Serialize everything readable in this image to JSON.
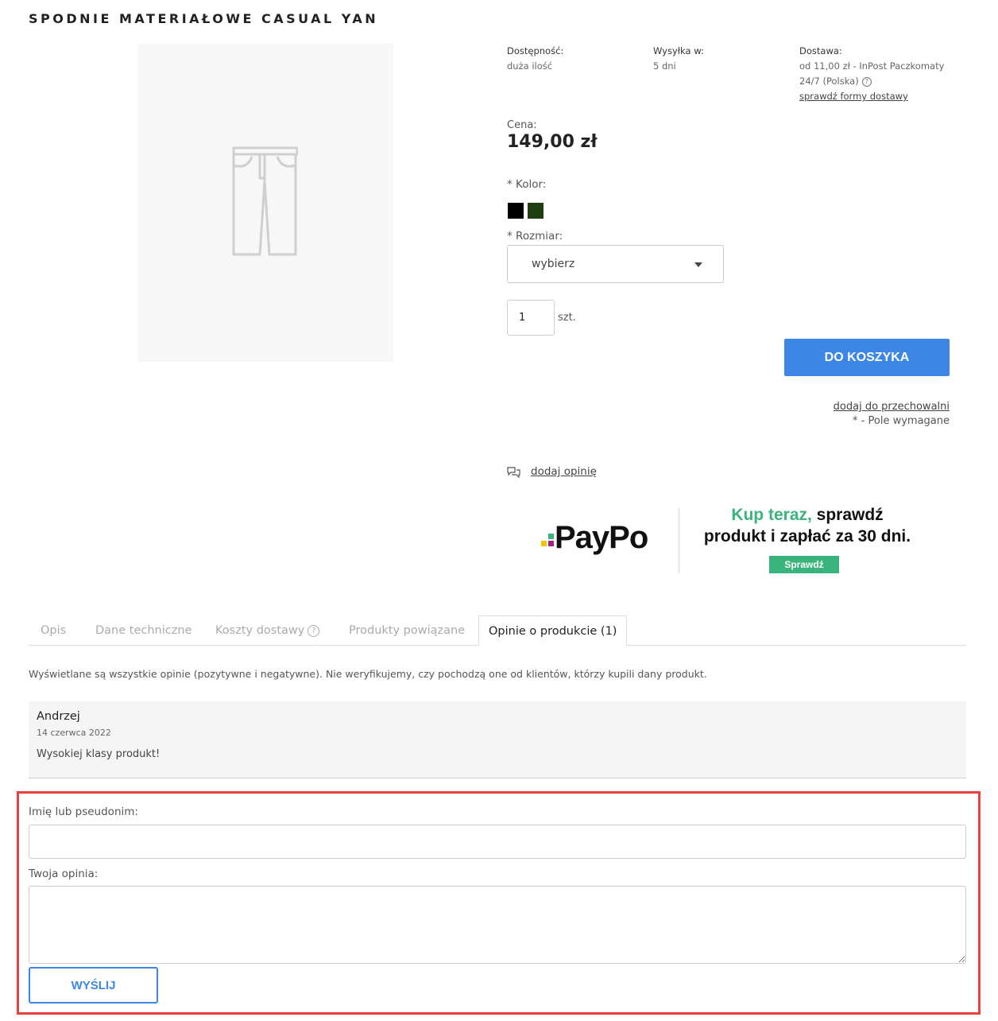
{
  "product": {
    "title": "SPODNIE MATERIAŁOWE CASUAL YAN"
  },
  "info": {
    "availability_label": "Dostępność:",
    "availability_value": "duża ilość",
    "shipping_label": "Wysyłka w:",
    "shipping_value": "5 dni",
    "delivery_label": "Dostawa:",
    "delivery_value_line1": "od 11,00 zł - InPost Paczkomaty",
    "delivery_value_line2": "24/7 (Polska)",
    "delivery_link": "sprawdź formy dostawy",
    "help_glyph": "?"
  },
  "price": {
    "label": "Cena:",
    "value": "149,00 zł"
  },
  "color": {
    "label": "* Kolor:",
    "swatches": [
      "#000000",
      "#1e3f12"
    ]
  },
  "size": {
    "label": "* Rozmiar:",
    "selected": "wybierz"
  },
  "quantity": {
    "value": "1",
    "unit": "szt."
  },
  "actions": {
    "add_to_cart": "DO KOSZYKA",
    "add_to_storage": "dodaj do przechowalni",
    "required_note": "* - Pole wymagane",
    "add_review": "dodaj opinię"
  },
  "paypo": {
    "logo_text": "PayPo",
    "headline_green": "Kup teraz,",
    "headline_rest": " sprawdź",
    "line2": "produkt i zapłać za 30 dni.",
    "button": "Sprawdź",
    "colors": {
      "green": "#3ab37d",
      "purple": "#a3247e",
      "yellow": "#f4c300"
    }
  },
  "tabs": [
    {
      "label": "Opis"
    },
    {
      "label": "Dane techniczne"
    },
    {
      "label": "Koszty dostawy"
    },
    {
      "label": "Produkty powiązane"
    },
    {
      "label": "Opinie o produkcie (1)"
    }
  ],
  "reviews": {
    "note": "Wyświetlane są wszystkie opinie (pozytywne i negatywne). Nie weryfikujemy, czy pochodzą one od klientów, którzy kupili dany produkt.",
    "items": [
      {
        "author": "Andrzej",
        "date": "14 czerwca 2022",
        "text": "Wysokiej klasy produkt!"
      }
    ]
  },
  "review_form": {
    "name_label": "Imię lub pseudonim:",
    "name_value": "",
    "opinion_label": "Twoja opinia:",
    "opinion_value": "",
    "submit": "WYŚLIJ"
  },
  "theme": {
    "accent": "#3c86e6",
    "highlight": "#e8403d"
  }
}
